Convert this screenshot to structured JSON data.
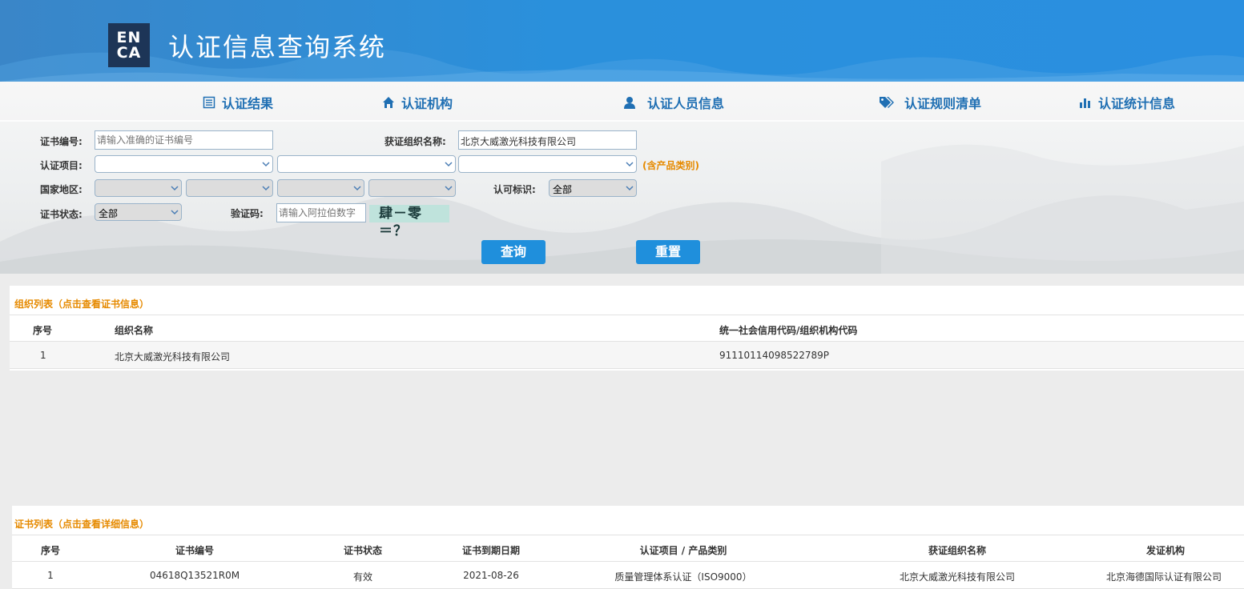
{
  "header": {
    "logo_top": "EN",
    "logo_bottom": "CA",
    "title": "认证信息查询系统"
  },
  "nav": [
    {
      "label": "认证结果",
      "icon": "list-icon"
    },
    {
      "label": "认证机构",
      "icon": "home-icon"
    },
    {
      "label": "认证人员信息",
      "icon": "user-icon"
    },
    {
      "label": "认证规则清单",
      "icon": "tags-icon"
    },
    {
      "label": "认证统计信息",
      "icon": "bar-chart-icon"
    }
  ],
  "search": {
    "cert_no_label": "证书编号:",
    "cert_no_placeholder": "请输入准确的证书编号",
    "org_name_label": "获证组织名称:",
    "org_name_value": "北京大威激光科技有限公司",
    "project_label": "认证项目:",
    "product_hint": "(含产品类别)",
    "region_label": "国家地区:",
    "accredit_label": "认可标识:",
    "accredit_value": "全部",
    "status_label": "证书状态:",
    "status_value": "全部",
    "captcha_label": "验证码:",
    "captcha_placeholder": "请输入阿拉伯数字",
    "captcha_text": "肆－零＝？",
    "query_button": "查询",
    "reset_button": "重置"
  },
  "org_list": {
    "title": "组织列表（点击查看证书信息）",
    "columns": [
      "序号",
      "组织名称",
      "统一社会信用代码/组织机构代码"
    ],
    "rows": [
      [
        "1",
        "北京大威激光科技有限公司",
        "91110114098522789P"
      ]
    ]
  },
  "cert_list": {
    "title": "证书列表（点击查看详细信息）",
    "columns": [
      "序号",
      "证书编号",
      "证书状态",
      "证书到期日期",
      "认证项目 / 产品类别",
      "获证组织名称",
      "发证机构"
    ],
    "rows": [
      [
        "1",
        "04618Q13521R0M",
        "有效",
        "2021-08-26",
        "质量管理体系认证（ISO9000）",
        "北京大威激光科技有限公司",
        "北京海德国际认证有限公司"
      ]
    ]
  },
  "colors": {
    "header_blue": "#2a8fe0",
    "nav_blue": "#1f6fb3",
    "accent_orange": "#e68a00",
    "button_blue": "#1f8fdc"
  }
}
